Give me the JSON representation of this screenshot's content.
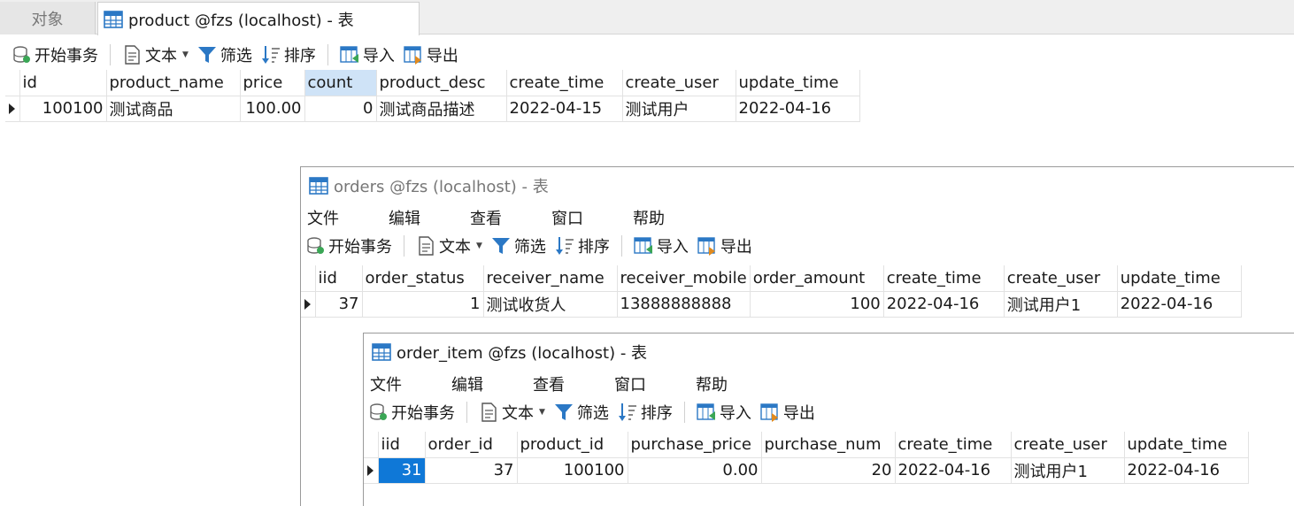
{
  "main_window": {
    "tabs": {
      "objects_label": "对象",
      "active_title": "product @fzs (localhost) - 表"
    },
    "toolbar": {
      "begin_transaction": "开始事务",
      "text": "文本",
      "filter": "筛选",
      "sort": "排序",
      "import": "导入",
      "export": "导出"
    },
    "grid": {
      "columns": [
        "id",
        "product_name",
        "price",
        "count",
        "product_desc",
        "create_time",
        "create_user",
        "update_time"
      ],
      "selected_column": "count",
      "rows": [
        [
          "100100",
          "测试商品",
          "100.00",
          "0",
          "测试商品描述",
          "2022-04-15",
          "测试用户",
          "2022-04-16"
        ]
      ]
    }
  },
  "orders_window": {
    "title": "orders @fzs (localhost) - 表",
    "menu": [
      "文件",
      "编辑",
      "查看",
      "窗口",
      "帮助"
    ],
    "toolbar": {
      "begin_transaction": "开始事务",
      "text": "文本",
      "filter": "筛选",
      "sort": "排序",
      "import": "导入",
      "export": "导出"
    },
    "grid": {
      "columns": [
        "iid",
        "order_status",
        "receiver_name",
        "receiver_mobile",
        "order_amount",
        "create_time",
        "create_user",
        "update_time"
      ],
      "rows": [
        [
          "37",
          "1",
          "测试收货人",
          "13888888888",
          "100",
          "2022-04-16",
          "测试用户1",
          "2022-04-16"
        ]
      ]
    }
  },
  "order_item_window": {
    "title": "order_item @fzs (localhost) - 表",
    "menu": [
      "文件",
      "编辑",
      "查看",
      "窗口",
      "帮助"
    ],
    "toolbar": {
      "begin_transaction": "开始事务",
      "text": "文本",
      "filter": "筛选",
      "sort": "排序",
      "import": "导入",
      "export": "导出"
    },
    "grid": {
      "columns": [
        "iid",
        "order_id",
        "product_id",
        "purchase_price",
        "purchase_num",
        "create_time",
        "create_user",
        "update_time"
      ],
      "rows": [
        [
          "31",
          "37",
          "100100",
          "0.00",
          "20",
          "2022-04-16",
          "测试用户1",
          "2022-04-16"
        ]
      ]
    }
  },
  "icons": {
    "table": "table-icon",
    "transaction": "database-icon",
    "text": "text-document-icon",
    "filter": "funnel-icon",
    "sort": "sort-icon",
    "import": "import-icon",
    "export": "export-icon"
  },
  "colors": {
    "selected_header": "#cfe3f7",
    "current_cell": "#0f78d7",
    "icon_blue": "#2b78c5",
    "icon_orange": "#e08a1e"
  }
}
